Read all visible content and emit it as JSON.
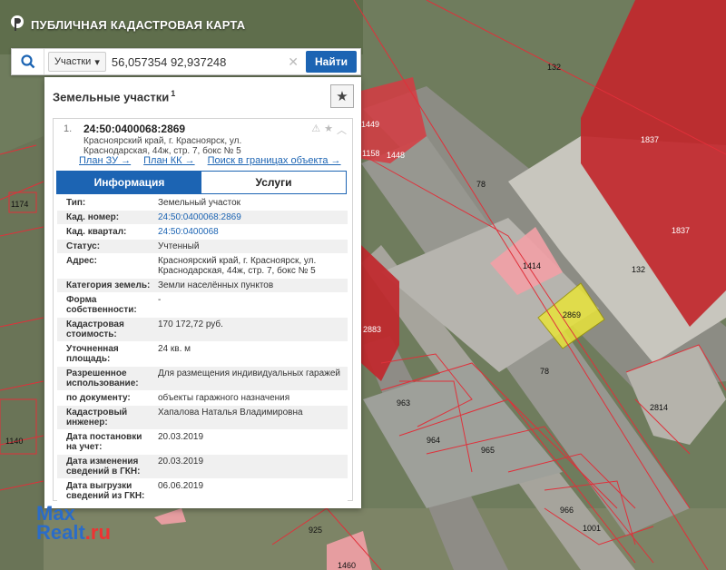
{
  "app": {
    "title": "ПУБЛИЧНАЯ КАДАСТРОВАЯ КАРТА"
  },
  "search": {
    "type_label": "Участки",
    "query": "56,057354 92,937248",
    "find_label": "Найти"
  },
  "panel": {
    "title": "Земельные участки",
    "count": "1"
  },
  "object": {
    "index": "1.",
    "cadastral_id": "24:50:0400068:2869",
    "address_line1": "Красноярский край, г. Красноярск, ул.",
    "address_line2": "Краснодарская, 44ж, стр. 7, бокс № 5",
    "links": [
      "План ЗУ →",
      "План КК →",
      "Поиск в границах объекта →"
    ]
  },
  "tabs": [
    "Информация",
    "Услуги"
  ],
  "details": [
    {
      "label": "Тип:",
      "value": "Земельный участок",
      "link": false
    },
    {
      "label": "Кад. номер:",
      "value": "24:50:0400068:2869",
      "link": true
    },
    {
      "label": "Кад. квартал:",
      "value": "24:50:0400068",
      "link": true
    },
    {
      "label": "Статус:",
      "value": "Учтенный",
      "link": false
    },
    {
      "label": "Адрес:",
      "value": "Красноярский край, г. Красноярск, ул. Краснодарская, 44ж, стр. 7, бокс № 5",
      "link": false
    },
    {
      "label": "Категория земель:",
      "value": "Земли населённых пунктов",
      "link": false
    },
    {
      "label": "Форма собственности:",
      "value": "-",
      "link": false
    },
    {
      "label": "Кадастровая стоимость:",
      "value": "170 172,72 руб.",
      "link": false
    },
    {
      "label": "Уточненная площадь:",
      "value": "24 кв. м",
      "link": false
    },
    {
      "label": "Разрешенное использование:",
      "value": "Для размещения индивидуальных гаражей",
      "link": false
    },
    {
      "label": "по документу:",
      "value": "объекты гаражного назначения",
      "link": false
    },
    {
      "label": "Кадастровый инженер:",
      "value": "Хапалова Наталья Владимировна",
      "link": false
    },
    {
      "label": "Дата постановки на учет:",
      "value": "20.03.2019",
      "link": false
    },
    {
      "label": "Дата изменения сведений в ГКН:",
      "value": "20.03.2019",
      "link": false
    },
    {
      "label": "Дата выгрузки сведений из ГКН:",
      "value": "06.06.2019",
      "link": false
    }
  ],
  "map_labels": [
    "132",
    "1449",
    "1158",
    "1448",
    "1837",
    "1174",
    "78",
    "1837",
    "1414",
    "132",
    "2869",
    "2883",
    "78",
    "963",
    "2814",
    "964",
    "965",
    "1140",
    "966",
    "925",
    "1001",
    "1460"
  ],
  "watermark": {
    "max": "Max",
    "realt": "Realt",
    "ru": ".ru"
  },
  "icons": {
    "search": "search-icon",
    "star": "star-icon",
    "logo": "pkk-logo-icon"
  }
}
